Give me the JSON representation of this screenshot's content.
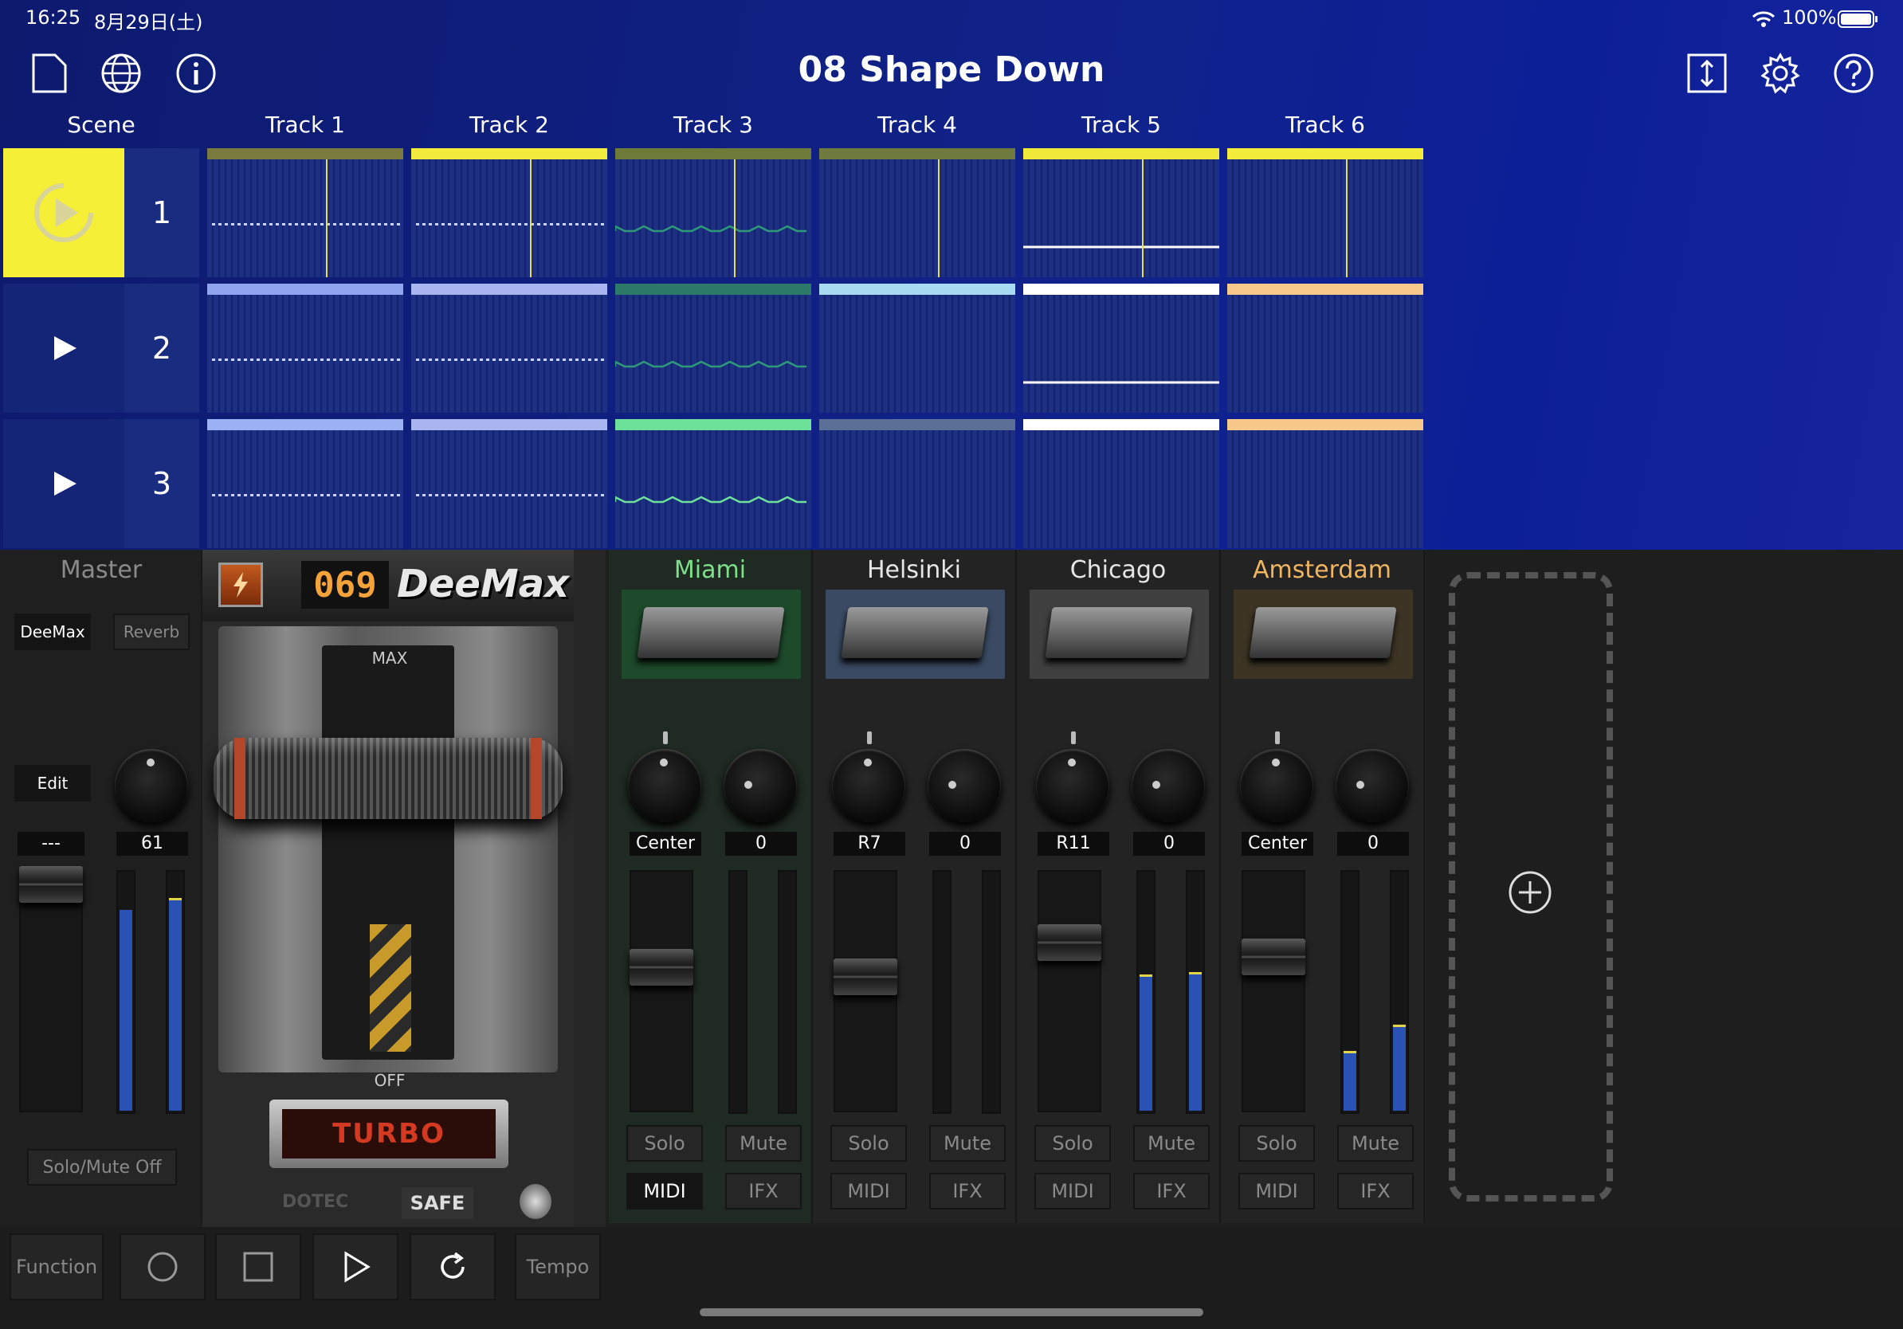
{
  "status": {
    "time": "16:25",
    "date": "8月29日(土)",
    "battery": "100%"
  },
  "title": "08 Shape Down",
  "header": {
    "scene_label": "Scene",
    "tracks": [
      "Track 1",
      "Track 2",
      "Track 3",
      "Track 4",
      "Track 5",
      "Track 6"
    ]
  },
  "scenes": [
    {
      "number": "1",
      "active": true
    },
    {
      "number": "2",
      "active": false
    },
    {
      "number": "3",
      "active": false
    }
  ],
  "clip_colors": [
    [
      "#7a7a3e",
      "#f2ea3c",
      "#6e7a3a",
      "#6f7a3e",
      "#f0e93a",
      "#f4ec3a"
    ],
    [
      "#8ea4ee",
      "#a9b6f2",
      "#2e7a6a",
      "#a9dcf3",
      "#ffffff",
      "#f7c98a"
    ],
    [
      "#9cb0f4",
      "#a9b6f2",
      "#6de09a",
      "#5c6f96",
      "#ffffff",
      "#f6c98a"
    ]
  ],
  "master": {
    "label": "Master",
    "fx_deemax": "DeeMax",
    "fx_reverb": "Reverb",
    "edit_label": "Edit",
    "pan_value": "---",
    "volume_value": "61",
    "solo_mute_off": "Solo/Mute Off",
    "fader_level": 0.94,
    "meter_left": 0.84,
    "meter_right": 0.88
  },
  "plugin": {
    "counter": "069",
    "name": "DeeMax",
    "max_label": "MAX",
    "off_label": "OFF",
    "turbo_label": "TURBO",
    "safe_label": "SAFE",
    "brand_label": "DOTEC"
  },
  "channels": [
    {
      "name": "Miami",
      "name_color": "#7ee08a",
      "thumb_bg": "#1d4a2a",
      "pan": "Center",
      "send": "0",
      "fader_level": 0.6,
      "meter_left": 0.0,
      "meter_right": 0.0,
      "solo": "Solo",
      "mute": "Mute",
      "midi": "MIDI",
      "ifx": "IFX",
      "midi_active": true
    },
    {
      "name": "Helsinki",
      "name_color": "#e6e6e6",
      "thumb_bg": "#3a4a62",
      "pan": "R7",
      "send": "0",
      "fader_level": 0.56,
      "meter_left": 0.0,
      "meter_right": 0.0,
      "solo": "Solo",
      "mute": "Mute",
      "midi": "MIDI",
      "ifx": "IFX",
      "midi_active": false
    },
    {
      "name": "Chicago",
      "name_color": "#e6e6e6",
      "thumb_bg": "#404040",
      "pan": "R11",
      "send": "0",
      "fader_level": 0.7,
      "meter_left": 0.56,
      "meter_right": 0.57,
      "solo": "Solo",
      "mute": "Mute",
      "midi": "MIDI",
      "ifx": "IFX",
      "midi_active": false
    },
    {
      "name": "Amsterdam",
      "name_color": "#f0b560",
      "thumb_bg": "#3d3424",
      "pan": "Center",
      "send": "0",
      "fader_level": 0.64,
      "meter_left": 0.24,
      "meter_right": 0.35,
      "solo": "Solo",
      "mute": "Mute",
      "midi": "MIDI",
      "ifx": "IFX",
      "midi_active": false
    }
  ],
  "transport": {
    "function_label": "Function",
    "tempo_label": "Tempo"
  },
  "icons": [
    "new-document-icon",
    "globe-icon",
    "info-icon",
    "resize-icon",
    "gear-icon",
    "help-icon",
    "record-icon",
    "stop-icon",
    "play-icon",
    "loop-icon",
    "add-icon"
  ]
}
